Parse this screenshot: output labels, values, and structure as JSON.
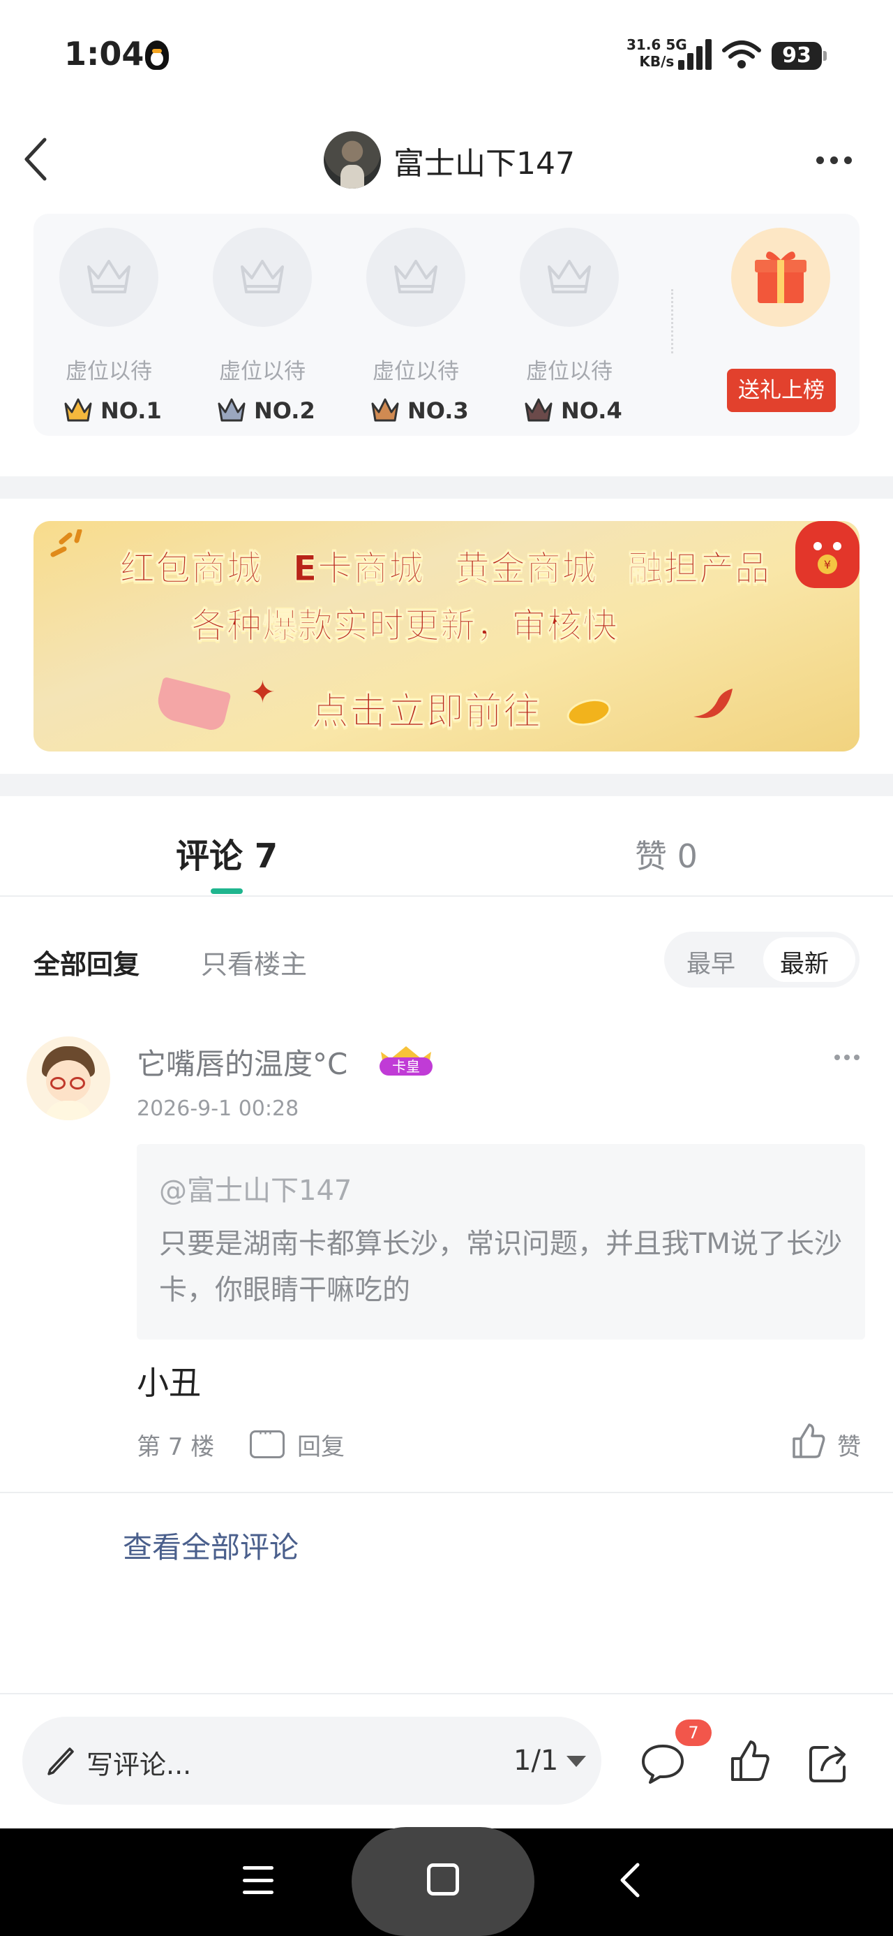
{
  "status_bar": {
    "time": "1:04",
    "net_speed_value": "31.6",
    "net_type": "5G",
    "net_speed_unit": "KB/s",
    "battery": "93"
  },
  "header": {
    "title": "富士山下147"
  },
  "ranking": {
    "slots": [
      {
        "placeholder": "虚位以待",
        "rank": "NO.1",
        "crown_color": "#f5b83d"
      },
      {
        "placeholder": "虚位以待",
        "rank": "NO.2",
        "crown_color": "#9aa7bf"
      },
      {
        "placeholder": "虚位以待",
        "rank": "NO.3",
        "crown_color": "#d08a52"
      },
      {
        "placeholder": "虚位以待",
        "rank": "NO.4",
        "crown_color": "#6b4a4a"
      }
    ],
    "gift_button": "送礼上榜"
  },
  "banner": {
    "line1": [
      "红包商城",
      "E卡商城",
      "黄金商城",
      "融担产品"
    ],
    "line2": "各种爆款实时更新，审核快",
    "line3": "点击立即前往"
  },
  "tabs": {
    "comments": "评论 7",
    "likes": "赞 0"
  },
  "filters": {
    "all": "全部回复",
    "op_only": "只看楼主",
    "sort_earliest": "最早",
    "sort_latest": "最新"
  },
  "comment": {
    "username": "它嘴唇的温度°C",
    "badge": "卡皇",
    "date": "2026-9-1 00:28",
    "quote_mention": "@富士山下147",
    "quote_text": "只要是湖南卡都算长沙，常识问题，并且我TM说了长沙卡，你眼睛干嘛吃的",
    "text": "小丑",
    "floor": "第 7 楼",
    "reply": "回复",
    "like": "赞"
  },
  "view_all": "查看全部评论",
  "bottom_bar": {
    "input_placeholder": "写评论...",
    "page": "1/1",
    "comment_count": "7"
  },
  "colors": {
    "accent": "#1fb58e",
    "gift_red": "#e2412d",
    "link": "#4a5f8c"
  }
}
